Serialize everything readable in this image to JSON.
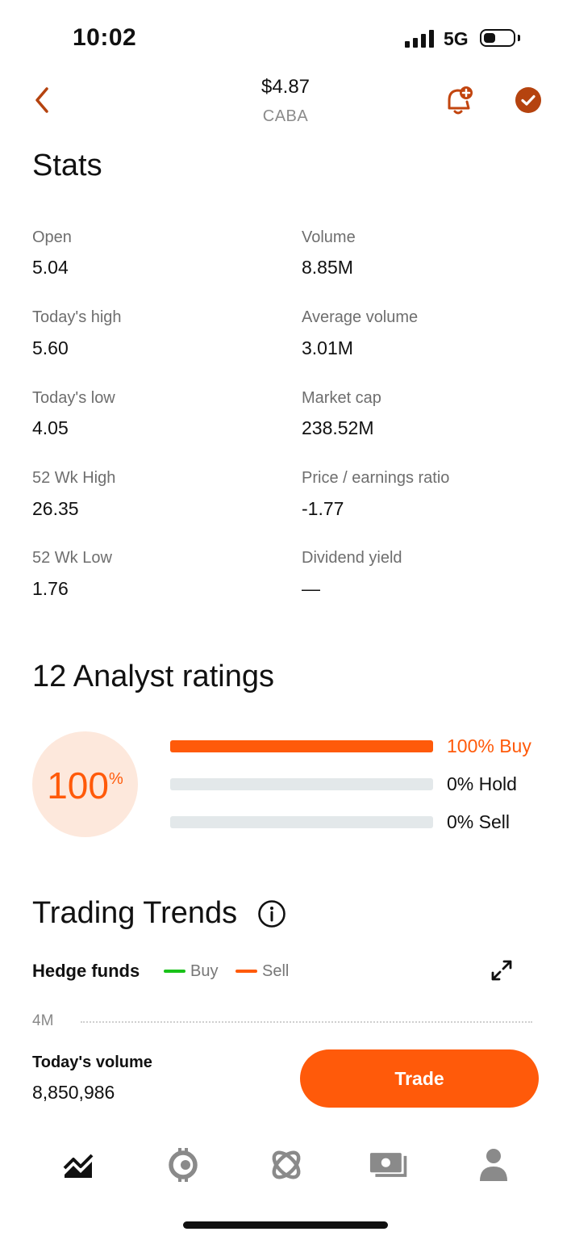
{
  "status_bar": {
    "time": "10:02",
    "network": "5G"
  },
  "header": {
    "price": "$4.87",
    "ticker": "CABA"
  },
  "stats": {
    "title": "Stats",
    "items": [
      {
        "label": "Open",
        "value": "5.04"
      },
      {
        "label": "Volume",
        "value": "8.85M"
      },
      {
        "label": "Today's high",
        "value": "5.60"
      },
      {
        "label": "Average volume",
        "value": "3.01M"
      },
      {
        "label": "Today's low",
        "value": "4.05"
      },
      {
        "label": "Market cap",
        "value": "238.52M"
      },
      {
        "label": "52 Wk High",
        "value": "26.35"
      },
      {
        "label": "Price / earnings ratio",
        "value": "-1.77"
      },
      {
        "label": "52 Wk Low",
        "value": "1.76"
      },
      {
        "label": "Dividend yield",
        "value": "—"
      }
    ]
  },
  "ratings": {
    "title": "12 Analyst ratings",
    "circle_value": "100",
    "circle_unit": "%",
    "rows": [
      {
        "label": "100% Buy",
        "percent": 100
      },
      {
        "label": "0% Hold",
        "percent": 0
      },
      {
        "label": "0% Sell",
        "percent": 0
      }
    ]
  },
  "trends": {
    "title": "Trading Trends",
    "subtitle": "Hedge funds",
    "legend": [
      {
        "label": "Buy",
        "color": "#19c219"
      },
      {
        "label": "Sell",
        "color": "#ff5a0a"
      }
    ],
    "y_tick": "4M"
  },
  "volume": {
    "label": "Today's volume",
    "value": "8,850,986"
  },
  "trade_button": {
    "label": "Trade"
  },
  "tab_bar": {
    "items": [
      {
        "name": "investing",
        "icon": "chart-line-icon"
      },
      {
        "name": "crypto",
        "icon": "crypto-icon"
      },
      {
        "name": "explore",
        "icon": "orbit-icon"
      },
      {
        "name": "cash",
        "icon": "cash-card-icon"
      },
      {
        "name": "account",
        "icon": "person-icon"
      }
    ]
  },
  "colors": {
    "accent": "#ff5a0a",
    "accent_light": "#fde8dc",
    "header_icon": "#b5430f"
  }
}
